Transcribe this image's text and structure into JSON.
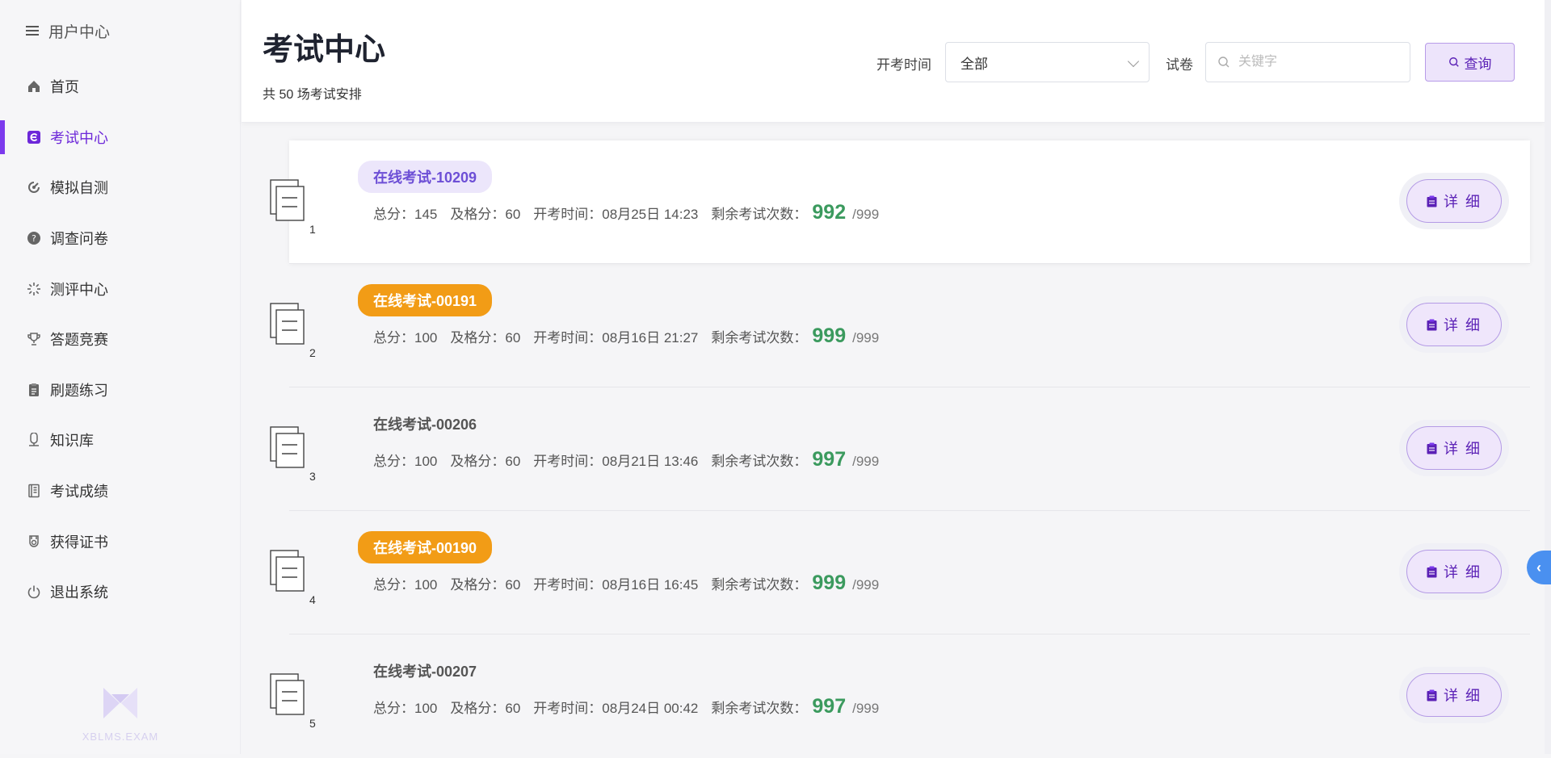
{
  "sidebar": {
    "header_label": "用户中心",
    "items": [
      {
        "label": "首页",
        "icon": "home-icon"
      },
      {
        "label": "考试中心",
        "icon": "exam-icon",
        "active": true
      },
      {
        "label": "模拟自测",
        "icon": "self-test-icon"
      },
      {
        "label": "调查问卷",
        "icon": "survey-icon"
      },
      {
        "label": "测评中心",
        "icon": "evaluation-icon"
      },
      {
        "label": "答题竞赛",
        "icon": "trophy-icon"
      },
      {
        "label": "刷题练习",
        "icon": "practice-icon"
      },
      {
        "label": "知识库",
        "icon": "knowledge-icon"
      },
      {
        "label": "考试成绩",
        "icon": "scores-icon"
      },
      {
        "label": "获得证书",
        "icon": "certificate-icon"
      },
      {
        "label": "退出系统",
        "icon": "power-icon"
      }
    ],
    "logo_text": "XBLMS.EXAM"
  },
  "header": {
    "title": "考试中心",
    "subtitle": "共 50 场考试安排",
    "time_filter_label": "开考时间",
    "time_filter_value": "全部",
    "paper_label": "试卷",
    "search_placeholder": "关键字",
    "query_label": "查询"
  },
  "exams": [
    {
      "index": "1",
      "title": "在线考试-10209",
      "style": "pill-light",
      "total_label": "总分：145",
      "pass_label": "及格分：60",
      "start_label": "开考时间：08月25日 14:23",
      "remain_label": "剩余考试次数：",
      "remain": "992",
      "remain_total": "/999",
      "detail_label": "详 细"
    },
    {
      "index": "2",
      "title": "在线考试-00191",
      "style": "pill-orange",
      "total_label": "总分：100",
      "pass_label": "及格分：60",
      "start_label": "开考时间：08月16日 21:27",
      "remain_label": "剩余考试次数：",
      "remain": "999",
      "remain_total": "/999",
      "detail_label": "详 细"
    },
    {
      "index": "3",
      "title": "在线考试-00206",
      "style": "plain",
      "total_label": "总分：100",
      "pass_label": "及格分：60",
      "start_label": "开考时间：08月21日 13:46",
      "remain_label": "剩余考试次数：",
      "remain": "997",
      "remain_total": "/999",
      "detail_label": "详 细"
    },
    {
      "index": "4",
      "title": "在线考试-00190",
      "style": "pill-orange",
      "total_label": "总分：100",
      "pass_label": "及格分：60",
      "start_label": "开考时间：08月16日 16:45",
      "remain_label": "剩余考试次数：",
      "remain": "999",
      "remain_total": "/999",
      "detail_label": "详 细"
    },
    {
      "index": "5",
      "title": "在线考试-00207",
      "style": "plain",
      "total_label": "总分：100",
      "pass_label": "及格分：60",
      "start_label": "开考时间：08月24日 00:42",
      "remain_label": "剩余考试次数：",
      "remain": "997",
      "remain_total": "/999",
      "detail_label": "详 细"
    }
  ],
  "side_tab_glyph": "‹",
  "colors": {
    "accent": "#7c3aed",
    "remain_green": "#3b9a5e",
    "orange_badge": "#f29c16",
    "side_tab": "#4a90f0"
  }
}
